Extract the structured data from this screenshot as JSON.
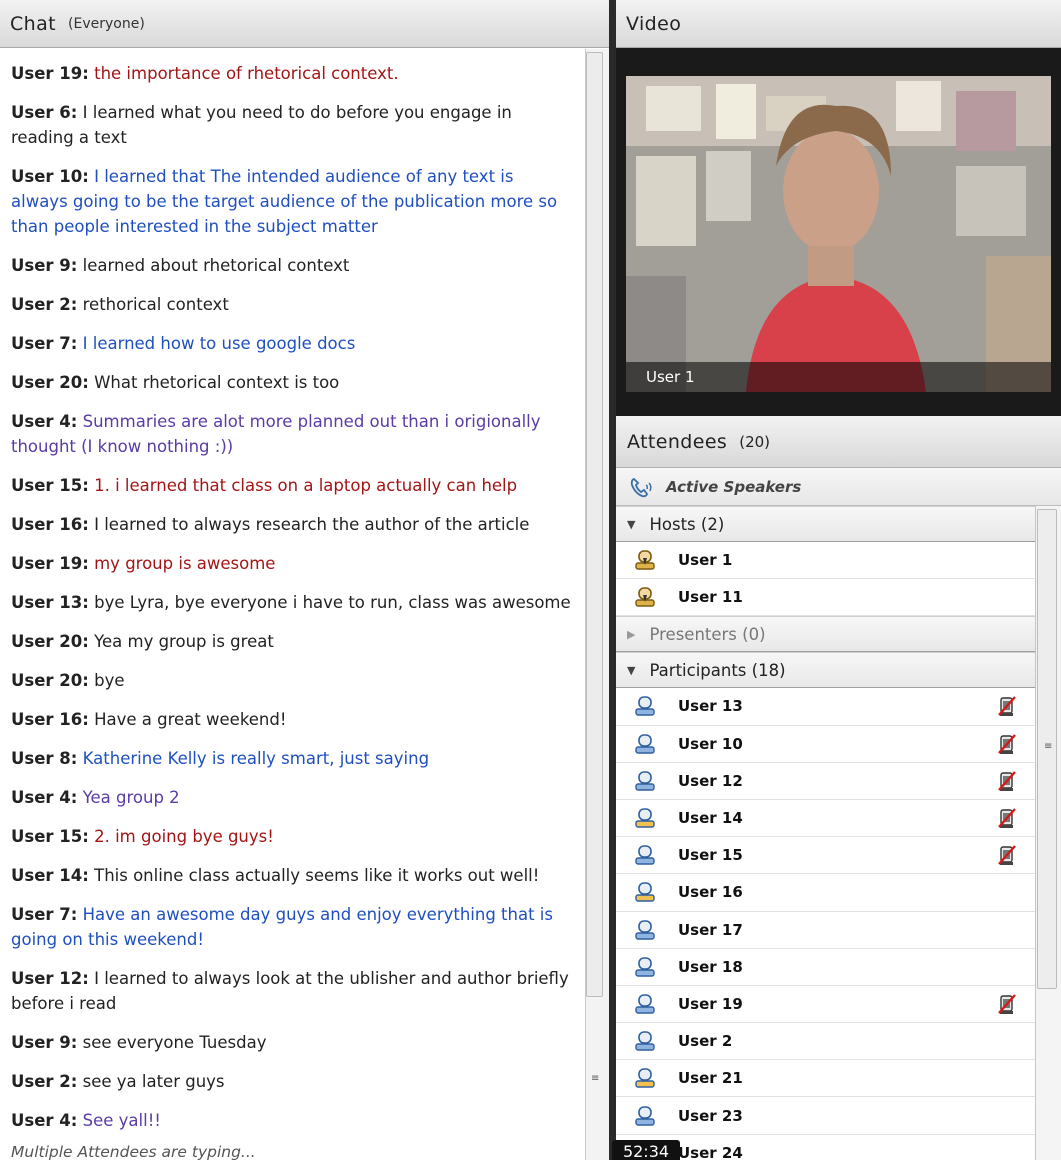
{
  "chat": {
    "title": "Chat",
    "audience": "(Everyone)",
    "messages": [
      {
        "user": "User 19:",
        "text": "the importance of rhetorical context.",
        "color": "red"
      },
      {
        "user": "User 6:",
        "text": "I learned what you need to do before you engage in reading a text",
        "color": "black"
      },
      {
        "user": "User 10:",
        "text": "I learned that The intended audience of any text is always going to be the target audience of the publication more so than people interested in the subject matter",
        "color": "blue"
      },
      {
        "user": "User 9:",
        "text": "learned about rhetorical context",
        "color": "black"
      },
      {
        "user": "User 2:",
        "text": "rethorical context",
        "color": "black"
      },
      {
        "user": "User 7:",
        "text": "I learned how to use google docs",
        "color": "blue"
      },
      {
        "user": "User 20:",
        "text": "What rhetorical context is too",
        "color": "black"
      },
      {
        "user": "User 4:",
        "text": "Summaries are alot more planned out than i origionally thought (I know nothing :))",
        "color": "purple"
      },
      {
        "user": "User 15:",
        "text": "1. i learned that class on a laptop actually can help",
        "color": "red"
      },
      {
        "user": "User 16:",
        "text": "I learned to always research the author of the article",
        "color": "black"
      },
      {
        "user": "User 19:",
        "text": "my group is awesome",
        "color": "red"
      },
      {
        "user": "User 13:",
        "text": "bye Lyra, bye everyone i have to run, class was awesome",
        "color": "black"
      },
      {
        "user": "User 20:",
        "text": "Yea my group is great",
        "color": "black"
      },
      {
        "user": "User 20:",
        "text": "bye",
        "color": "black"
      },
      {
        "user": "User 16:",
        "text": "Have a great weekend!",
        "color": "black"
      },
      {
        "user": "User 8:",
        "text": "Katherine Kelly is really smart, just saying",
        "color": "blue"
      },
      {
        "user": "User 4:",
        "text": "Yea group 2",
        "color": "purple"
      },
      {
        "user": "User 15:",
        "text": "2. im going bye guys!",
        "color": "red"
      },
      {
        "user": "User 14:",
        "text": "This online class actually seems like it works out well!",
        "color": "black"
      },
      {
        "user": "User 7:",
        "text": "Have an awesome day guys and enjoy everything that is going on this weekend!",
        "color": "blue"
      },
      {
        "user": "User 12:",
        "text": "I learned to always look at the ublisher and author briefly before i read",
        "color": "black"
      },
      {
        "user": "User 9:",
        "text": "see everyone Tuesday",
        "color": "black"
      },
      {
        "user": "User 2:",
        "text": "see ya later guys",
        "color": "black"
      },
      {
        "user": "User 4:",
        "text": "See yall!!",
        "color": "purple"
      }
    ],
    "typing_status": "Multiple Attendees are typing..."
  },
  "video": {
    "title": "Video",
    "caption": "User 1"
  },
  "attendees": {
    "title": "Attendees",
    "count": "(20)",
    "active_speakers": "Active Speakers",
    "groups": [
      {
        "label": "Hosts (2)",
        "expanded": true,
        "members": [
          {
            "name": "User 1",
            "role": "host",
            "mic_muted": false
          },
          {
            "name": "User 11",
            "role": "host",
            "mic_muted": false
          }
        ]
      },
      {
        "label": "Presenters (0)",
        "expanded": false,
        "members": []
      },
      {
        "label": "Participants (18)",
        "expanded": true,
        "members": [
          {
            "name": "User 13",
            "role": "participant",
            "mic_muted": true
          },
          {
            "name": "User 10",
            "role": "participant",
            "mic_muted": true
          },
          {
            "name": "User 12",
            "role": "participant",
            "mic_muted": true
          },
          {
            "name": "User 14",
            "role": "participant-yellow",
            "mic_muted": true
          },
          {
            "name": "User 15",
            "role": "participant",
            "mic_muted": true
          },
          {
            "name": "User 16",
            "role": "participant-yellow",
            "mic_muted": false
          },
          {
            "name": "User 17",
            "role": "participant",
            "mic_muted": false
          },
          {
            "name": "User 18",
            "role": "participant",
            "mic_muted": false
          },
          {
            "name": "User 19",
            "role": "participant",
            "mic_muted": true
          },
          {
            "name": "User 2",
            "role": "participant",
            "mic_muted": false
          },
          {
            "name": "User 21",
            "role": "participant-yellow",
            "mic_muted": false
          },
          {
            "name": "User 23",
            "role": "participant",
            "mic_muted": false
          },
          {
            "name": "User 24",
            "role": "participant",
            "mic_muted": false
          }
        ]
      }
    ]
  },
  "timer": "52:34",
  "colors": {
    "red": "#a31515",
    "blue": "#1f4fbf",
    "purple": "#5b3ba5",
    "black": "#222222"
  },
  "icons": {
    "phone": "phone-icon",
    "host_avatar": "host-avatar-icon",
    "participant_avatar": "participant-avatar-icon",
    "muted_mic": "muted-mic-icon"
  }
}
